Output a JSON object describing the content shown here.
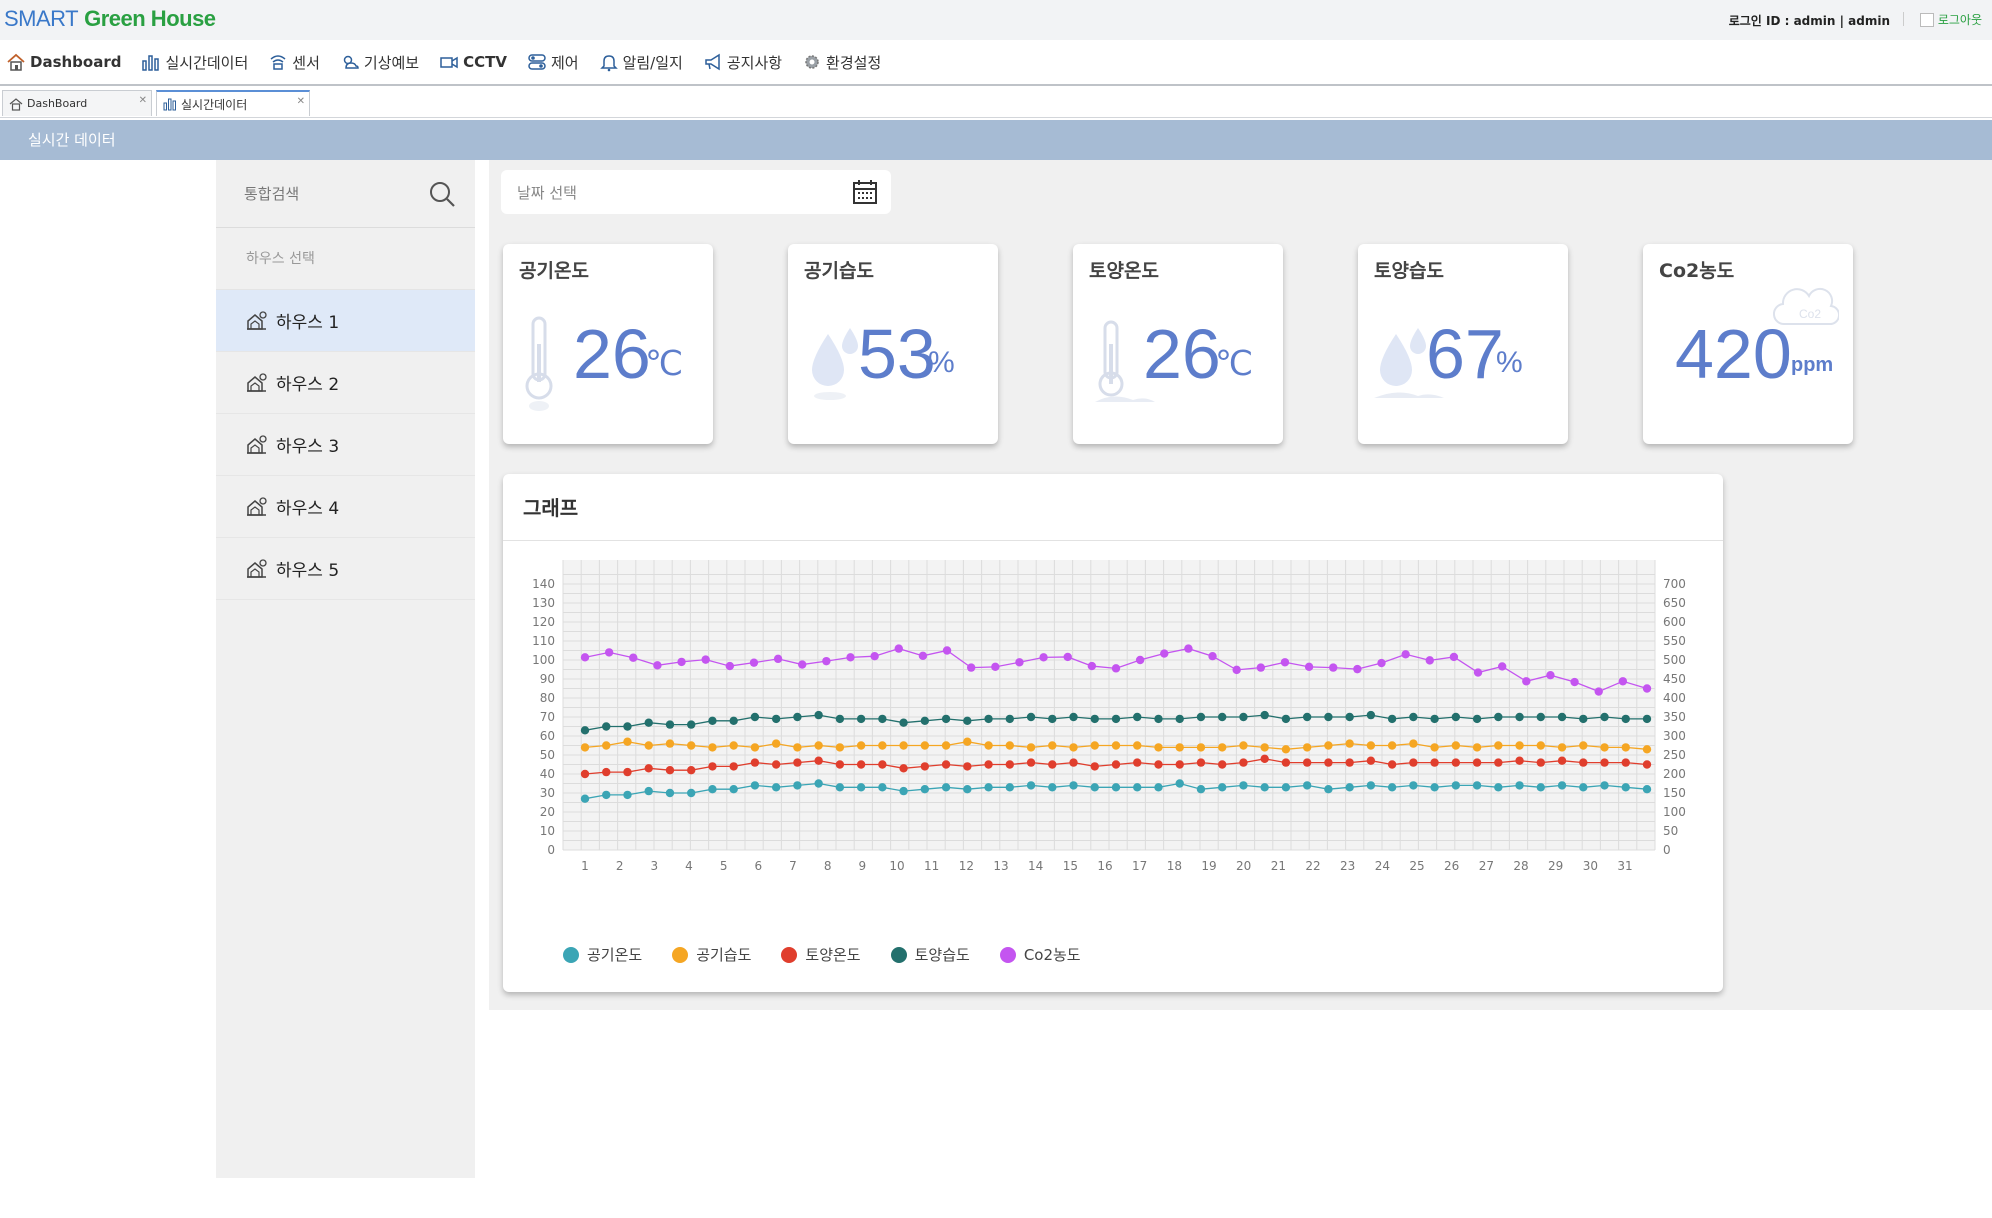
{
  "app": {
    "logo_smart": "SMART",
    "logo_green": "Green House",
    "login_info": "로그인 ID : admin | admin",
    "logout": "로그아웃"
  },
  "menu": [
    {
      "label": "Dashboard",
      "icon": "home-icon"
    },
    {
      "label": "실시간데이터",
      "icon": "bar-chart-icon"
    },
    {
      "label": "센서",
      "icon": "sensor-icon"
    },
    {
      "label": "기상예보",
      "icon": "weather-icon"
    },
    {
      "label": "CCTV",
      "icon": "camera-icon"
    },
    {
      "label": "제어",
      "icon": "control-icon"
    },
    {
      "label": "알림/일지",
      "icon": "bell-icon"
    },
    {
      "label": "공지사항",
      "icon": "megaphone-icon"
    },
    {
      "label": "환경설정",
      "icon": "gear-icon"
    }
  ],
  "tabs": [
    {
      "label": "DashBoard",
      "active": false
    },
    {
      "label": "실시간데이터",
      "active": true
    }
  ],
  "section_title": "실시간 데이터",
  "sidebar": {
    "search_placeholder": "통합검색",
    "house_header": "하우스 선택",
    "houses": [
      "하우스 1",
      "하우스 2",
      "하우스 3",
      "하우스 4",
      "하우스 5"
    ],
    "selected": 0
  },
  "date_placeholder": "날짜 선택",
  "cards": [
    {
      "title": "공기온도",
      "value": "26",
      "unit": "℃",
      "icon": "thermometer-icon"
    },
    {
      "title": "공기습도",
      "value": "53",
      "unit": "%",
      "icon": "water-drop-icon"
    },
    {
      "title": "토양온도",
      "value": "26",
      "unit": "℃",
      "icon": "soil-thermometer-icon"
    },
    {
      "title": "토양습도",
      "value": "67",
      "unit": "%",
      "icon": "soil-drop-icon"
    },
    {
      "title": "Co2농도",
      "value": "420",
      "unit": "ppm",
      "icon": "co2-cloud-icon"
    }
  ],
  "graph_title": "그래프",
  "colors": {
    "series": [
      "#3ba5b5",
      "#f5a623",
      "#e03e2d",
      "#23706d",
      "#c455f0"
    ],
    "value_text": "#5d7dcb"
  },
  "chart_data": {
    "type": "line",
    "x": [
      1,
      2,
      3,
      4,
      5,
      6,
      7,
      8,
      9,
      10,
      11,
      12,
      13,
      14,
      15,
      16,
      17,
      18,
      19,
      20,
      21,
      22,
      23,
      24,
      25,
      26,
      27,
      28,
      29,
      30,
      31
    ],
    "x_ticks": [
      "1",
      "2",
      "3",
      "4",
      "5",
      "6",
      "7",
      "8",
      "9",
      "10",
      "11",
      "12",
      "13",
      "14",
      "15",
      "16",
      "17",
      "18",
      "19",
      "20",
      "21",
      "22",
      "23",
      "24",
      "25",
      "26",
      "27",
      "28",
      "29",
      "30",
      "31"
    ],
    "y_left_ticks": [
      0,
      10,
      20,
      30,
      40,
      50,
      60,
      70,
      80,
      90,
      100,
      110,
      120,
      130,
      140
    ],
    "y_right_ticks": [
      0,
      50,
      100,
      150,
      200,
      250,
      300,
      350,
      400,
      450,
      500,
      550,
      600,
      650,
      700
    ],
    "ylim_left": [
      0,
      140
    ],
    "ylim_right": [
      0,
      700
    ],
    "grid": true,
    "legend_position": "bottom-left",
    "series": [
      {
        "name": "공기온도",
        "axis": "left",
        "values": [
          27,
          29,
          29,
          31,
          30,
          30,
          32,
          32,
          34,
          33,
          34,
          35,
          33,
          33,
          33,
          31,
          32,
          33,
          32,
          33,
          33,
          34,
          33,
          34,
          33,
          33,
          33,
          33,
          35,
          32,
          33,
          34,
          33,
          33,
          34,
          32,
          33,
          34,
          33,
          34,
          33,
          34,
          34,
          33,
          34,
          33,
          34,
          33,
          34,
          33,
          32
        ]
      },
      {
        "name": "공기습도",
        "axis": "left",
        "values": [
          54,
          55,
          57,
          55,
          56,
          55,
          54,
          55,
          54,
          56,
          54,
          55,
          54,
          55,
          55,
          55,
          55,
          55,
          57,
          55,
          55,
          54,
          55,
          54,
          55,
          55,
          55,
          54,
          54,
          54,
          54,
          55,
          54,
          53,
          54,
          55,
          56,
          55,
          55,
          56,
          54,
          55,
          54,
          55,
          55,
          55,
          54,
          55,
          54,
          54,
          53
        ]
      },
      {
        "name": "토양온도",
        "axis": "left",
        "values": [
          40,
          41,
          41,
          43,
          42,
          42,
          44,
          44,
          46,
          45,
          46,
          47,
          45,
          45,
          45,
          43,
          44,
          45,
          44,
          45,
          45,
          46,
          45,
          46,
          44,
          45,
          46,
          45,
          45,
          46,
          45,
          46,
          48,
          46,
          46,
          46,
          46,
          47,
          45,
          46,
          46,
          46,
          46,
          46,
          47,
          46,
          47,
          46,
          46,
          46,
          45
        ]
      },
      {
        "name": "토양습도",
        "axis": "left",
        "values": [
          63,
          65,
          65,
          67,
          66,
          66,
          68,
          68,
          70,
          69,
          70,
          71,
          69,
          69,
          69,
          67,
          68,
          69,
          68,
          69,
          69,
          70,
          69,
          70,
          69,
          69,
          70,
          69,
          69,
          70,
          70,
          70,
          71,
          69,
          70,
          70,
          70,
          71,
          69,
          70,
          69,
          70,
          69,
          70,
          70,
          70,
          70,
          69,
          70,
          69,
          69
        ]
      }
    ],
    "series_right": [
      {
        "name": "Co2농도",
        "axis": "right",
        "values": [
          507,
          520,
          506,
          486,
          495,
          501,
          484,
          493,
          503,
          488,
          497,
          507,
          510,
          530,
          511,
          525,
          480,
          482,
          494,
          507,
          508,
          484,
          478,
          500,
          517,
          530,
          510,
          474,
          480,
          494,
          482,
          480,
          476,
          492,
          515,
          499,
          508,
          467,
          483,
          444,
          460,
          442,
          417,
          444,
          425
        ]
      }
    ]
  }
}
